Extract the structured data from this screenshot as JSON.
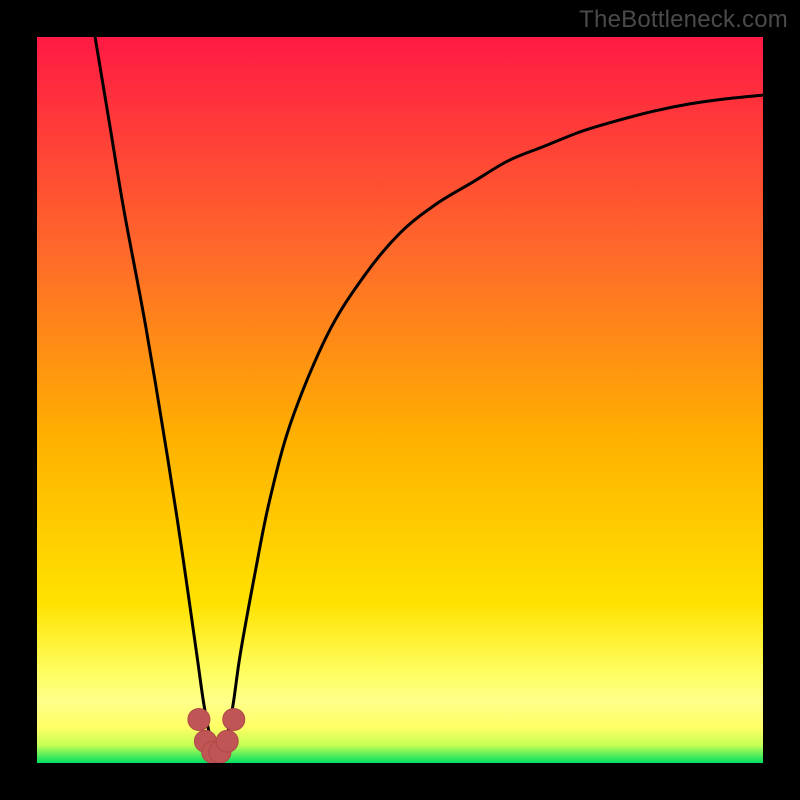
{
  "watermark": "TheBottleneck.com",
  "colors": {
    "frame": "#000000",
    "grad_top": "#ff1a44",
    "grad_mid1": "#ff6a2a",
    "grad_mid2": "#ffb000",
    "grad_mid3": "#ffe200",
    "grad_band_bright": "#ffff8a",
    "grad_bottom": "#00e060",
    "curve": "#000000",
    "marker_fill": "#c05555",
    "marker_stroke": "#b04848"
  },
  "chart_data": {
    "type": "line",
    "title": "",
    "xlabel": "",
    "ylabel": "",
    "xlim": [
      0,
      100
    ],
    "ylim": [
      0,
      100
    ],
    "x": [
      8,
      10,
      12,
      15,
      18,
      20,
      22,
      23,
      24,
      25,
      26,
      27,
      28,
      30,
      32,
      35,
      40,
      45,
      50,
      55,
      60,
      65,
      70,
      75,
      80,
      85,
      90,
      95,
      100
    ],
    "y": [
      100,
      88,
      76,
      60,
      42,
      29,
      15,
      8,
      3,
      1,
      3,
      8,
      15,
      26,
      36,
      47,
      59,
      67,
      73,
      77,
      80,
      83,
      85,
      87,
      88.5,
      89.8,
      90.8,
      91.5,
      92
    ],
    "series": [
      {
        "name": "bottleneck-curve",
        "x": [
          8,
          10,
          12,
          15,
          18,
          20,
          22,
          23,
          24,
          25,
          26,
          27,
          28,
          30,
          32,
          35,
          40,
          45,
          50,
          55,
          60,
          65,
          70,
          75,
          80,
          85,
          90,
          95,
          100
        ],
        "y": [
          100,
          88,
          76,
          60,
          42,
          29,
          15,
          8,
          3,
          1,
          3,
          8,
          15,
          26,
          36,
          47,
          59,
          67,
          73,
          77,
          80,
          83,
          85,
          87,
          88.5,
          89.8,
          90.8,
          91.5,
          92
        ]
      }
    ],
    "markers": [
      {
        "x": 22.3,
        "y": 6
      },
      {
        "x": 23.2,
        "y": 3
      },
      {
        "x": 24.2,
        "y": 1.5
      },
      {
        "x": 25.2,
        "y": 1.5
      },
      {
        "x": 26.2,
        "y": 3
      },
      {
        "x": 27.1,
        "y": 6
      }
    ]
  }
}
